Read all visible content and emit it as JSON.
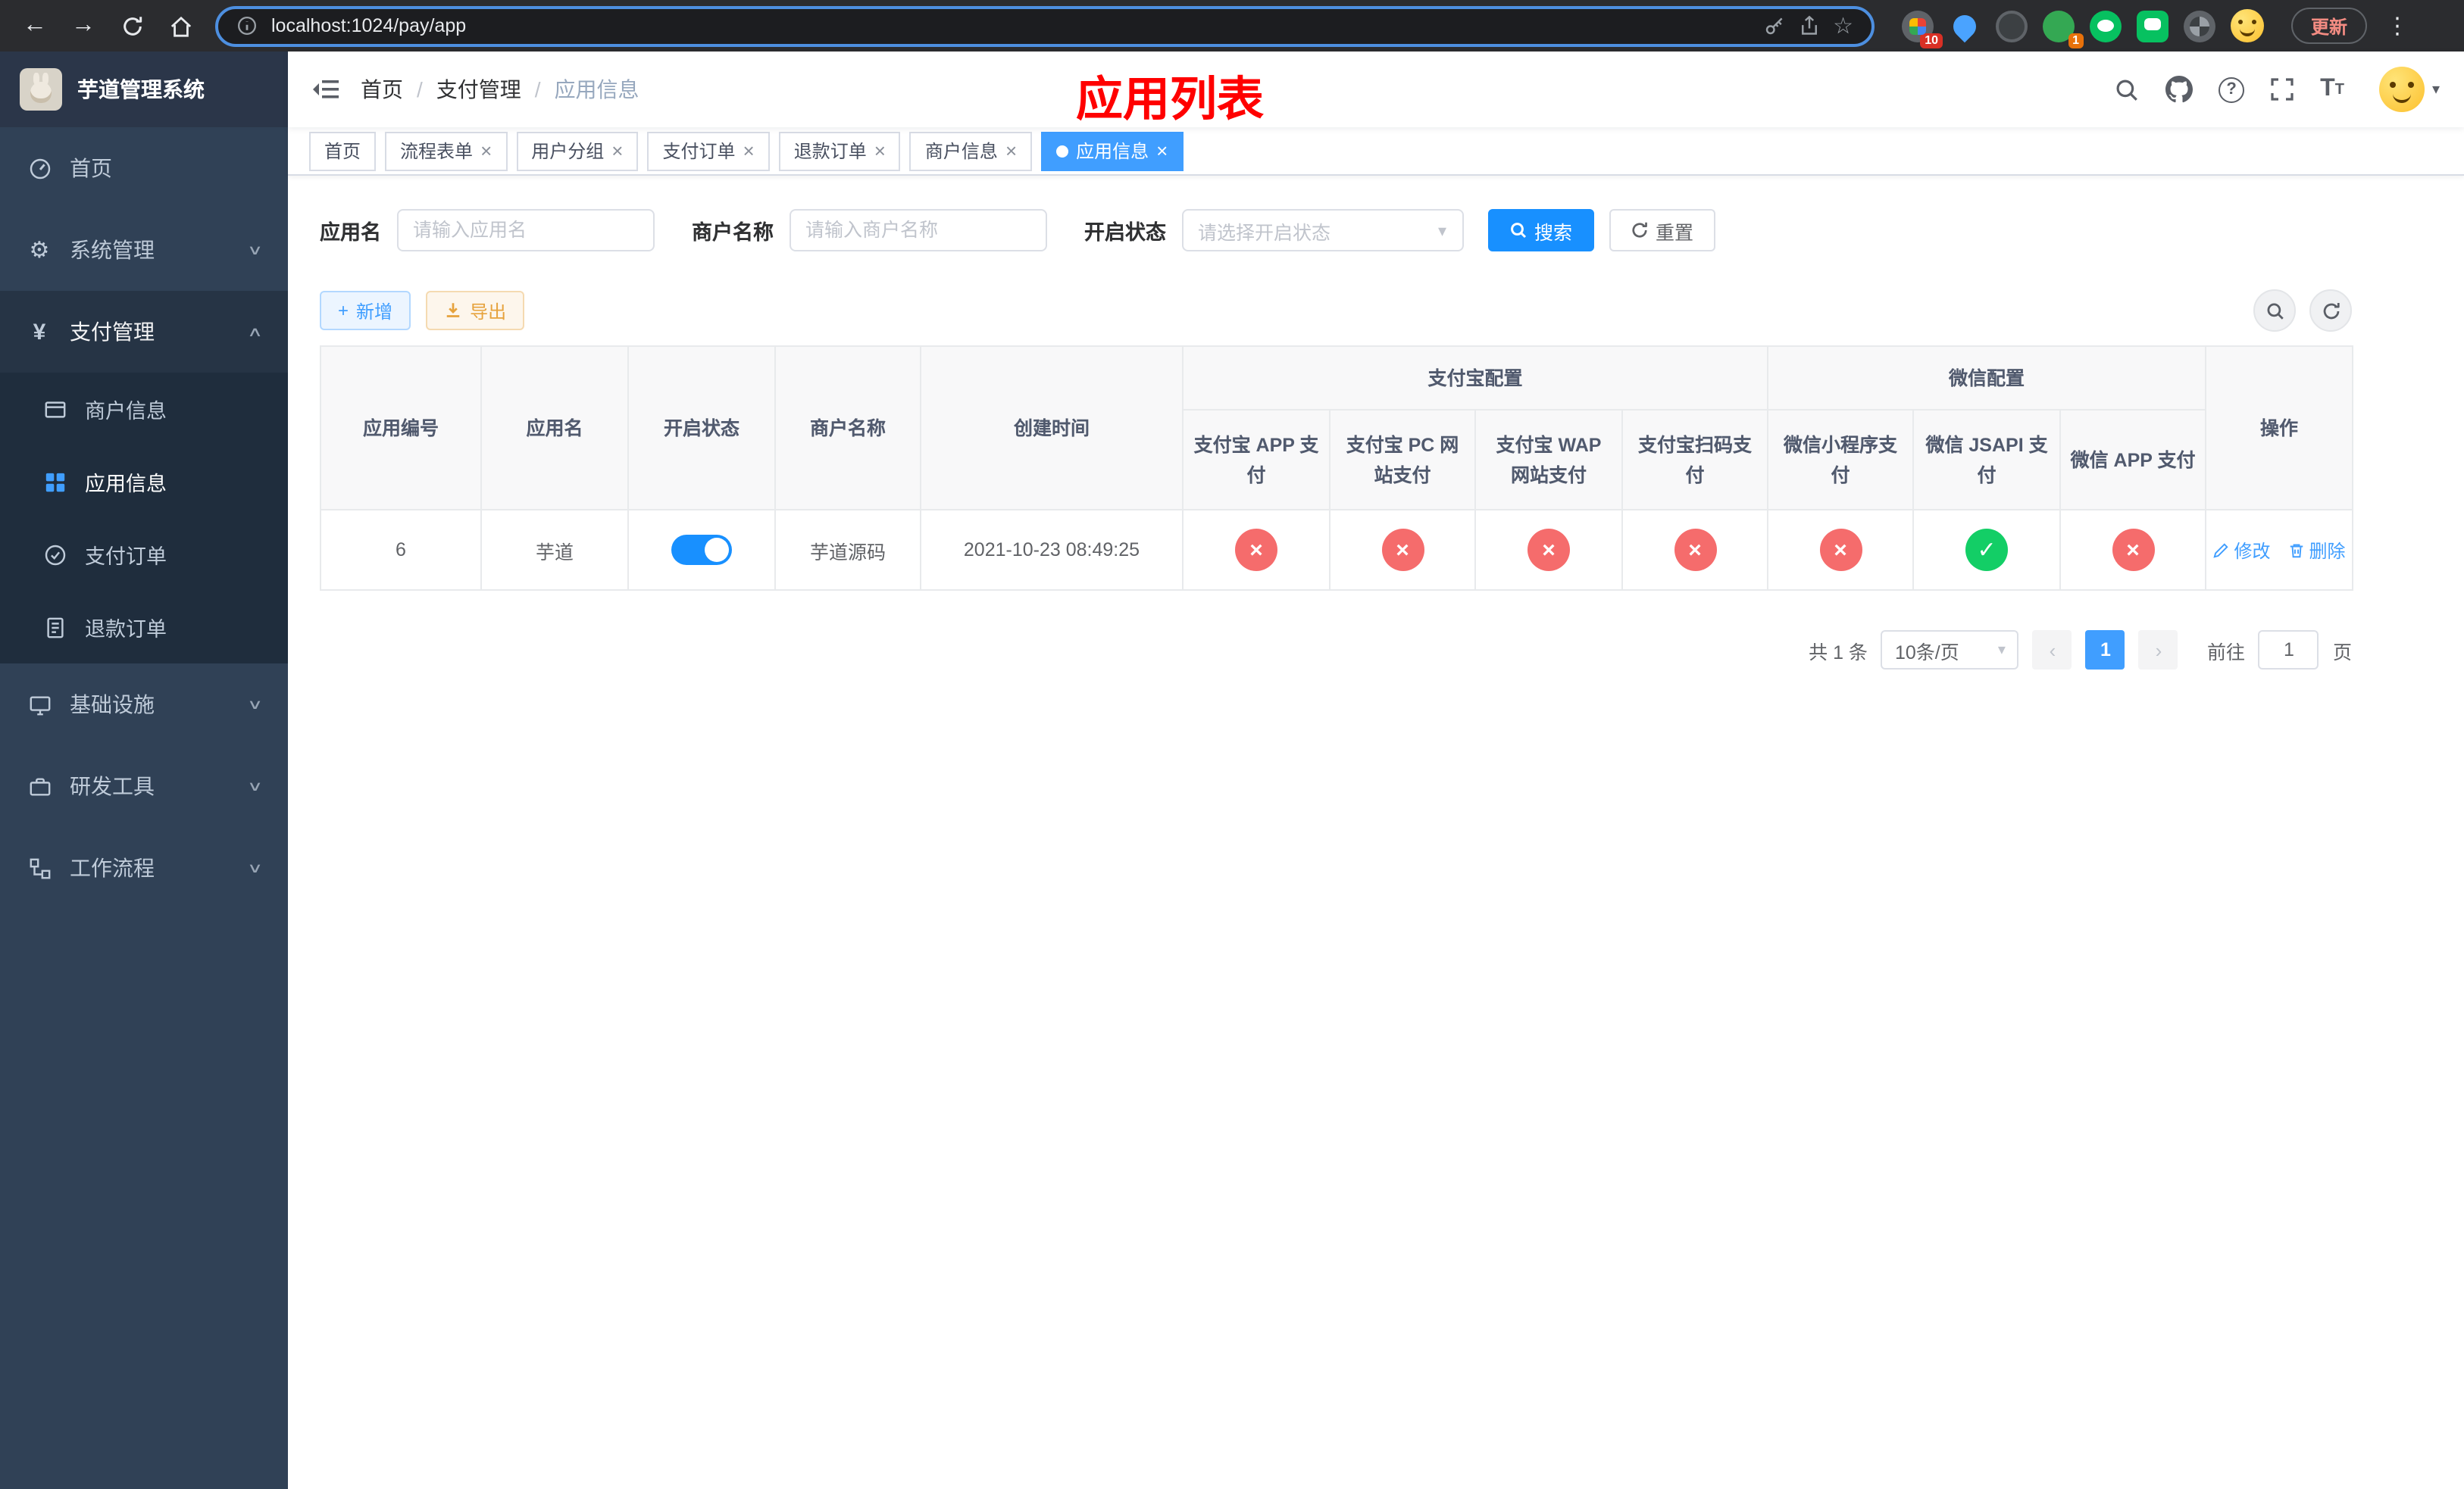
{
  "browser": {
    "url": "localhost:1024/pay/app",
    "update_label": "更新",
    "ext_badge_1": "10",
    "ext_badge_2": "1"
  },
  "icons": {
    "back": "←",
    "forward": "→",
    "star": "☆",
    "menu": "⋮",
    "gear": "⚙",
    "yen": "¥",
    "chevron_down": "∨",
    "chevron_up": "∧",
    "caret_down": "▾",
    "prev": "‹",
    "next": "›",
    "question": "?",
    "plus": "+",
    "check": "✓",
    "cross": "×",
    "close": "×"
  },
  "colors": {
    "primary": "#409eff",
    "primary_deep": "#1890ff",
    "danger": "#f56c6c",
    "success": "#13ce66",
    "warning": "#e6a23c",
    "title_red": "#ff0000",
    "sidebar_bg": "#304156"
  },
  "sidebar": {
    "title": "芋道管理系统",
    "items": [
      {
        "label": "首页"
      },
      {
        "label": "系统管理"
      },
      {
        "label": "支付管理"
      },
      {
        "label": "基础设施"
      },
      {
        "label": "研发工具"
      },
      {
        "label": "工作流程"
      }
    ],
    "payment_children": [
      {
        "label": "商户信息"
      },
      {
        "label": "应用信息"
      },
      {
        "label": "支付订单"
      },
      {
        "label": "退款订单"
      }
    ]
  },
  "header": {
    "breadcrumb": [
      "首页",
      "支付管理",
      "应用信息"
    ],
    "page_title": "应用列表",
    "textsize_big": "T",
    "textsize_small": "T"
  },
  "tabs": [
    {
      "label": "首页"
    },
    {
      "label": "流程表单"
    },
    {
      "label": "用户分组"
    },
    {
      "label": "支付订单"
    },
    {
      "label": "退款订单"
    },
    {
      "label": "商户信息"
    },
    {
      "label": "应用信息"
    }
  ],
  "filters": {
    "app_name_label": "应用名",
    "app_name_placeholder": "请输入应用名",
    "merchant_name_label": "商户名称",
    "merchant_name_placeholder": "请输入商户名称",
    "status_label": "开启状态",
    "status_placeholder": "请选择开启状态",
    "search_label": "搜索",
    "reset_label": "重置"
  },
  "toolbar": {
    "add_label": "新增",
    "export_label": "导出"
  },
  "table": {
    "simple_columns": [
      "应用编号",
      "应用名",
      "开启状态",
      "商户名称",
      "创建时间"
    ],
    "alipay_group": "支付宝配置",
    "alipay_columns": [
      "支付宝 APP 支付",
      "支付宝 PC 网站支付",
      "支付宝 WAP 网站支付",
      "支付宝扫码支付"
    ],
    "wechat_group": "微信配置",
    "wechat_columns": [
      "微信小程序支付",
      "微信 JSAPI 支付",
      "微信 APP 支付"
    ],
    "actions_column": "操作",
    "rows": [
      {
        "id": "6",
        "name": "芋道",
        "status_on": true,
        "merchant": "芋道源码",
        "created": "2021-10-23 08:49:25",
        "configs": [
          "no",
          "no",
          "no",
          "no",
          "no",
          "yes",
          "no"
        ],
        "edit_label": "修改",
        "delete_label": "删除"
      }
    ]
  },
  "pagination": {
    "total": "共 1 条",
    "page_size": "10条/页",
    "page": "1",
    "goto_label": "前往",
    "goto_value": "1",
    "unit_label": "页"
  }
}
